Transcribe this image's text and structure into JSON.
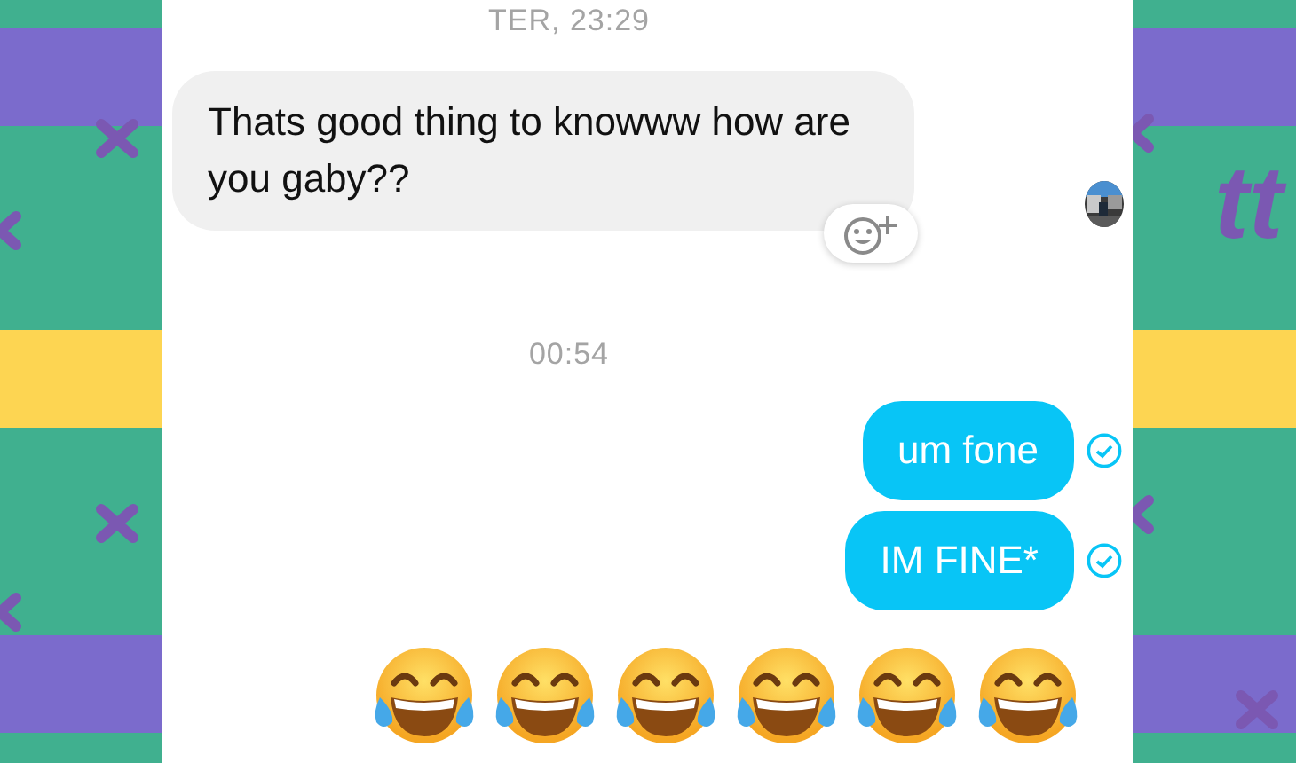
{
  "side_text": "tt",
  "messages": [
    {
      "kind": "timestamp",
      "text": "TER, 23:29"
    },
    {
      "kind": "received",
      "text": "Thats good thing to knowww how are you gaby??",
      "reaction_button": true,
      "seen_avatar": true
    },
    {
      "kind": "timestamp",
      "text": "00:54"
    },
    {
      "kind": "sent",
      "text": "um fone",
      "delivered": true
    },
    {
      "kind": "sent",
      "text": "IM FINE*",
      "delivered": true
    },
    {
      "kind": "emoji",
      "emojis": [
        {
          "kind": "tears_of_joy"
        },
        {
          "kind": "tears_of_joy"
        },
        {
          "kind": "tears_of_joy"
        },
        {
          "kind": "tears_of_joy"
        },
        {
          "kind": "tears_of_joy"
        },
        {
          "kind": "tears_of_joy"
        }
      ]
    }
  ]
}
